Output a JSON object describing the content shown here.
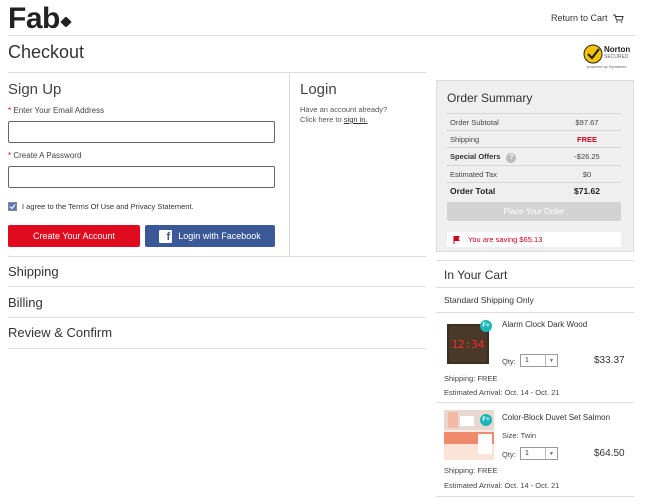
{
  "header": {
    "logo": "Fab",
    "return_to_cart": "Return to Cart"
  },
  "page_title": "Checkout",
  "norton": {
    "line1": "Norton",
    "line2": "SECURED",
    "line3": "powered by Symantec"
  },
  "signup": {
    "title": "Sign Up",
    "email_label": "Enter Your Email Address",
    "password_label": "Create A Password",
    "required_mark": "*",
    "agree_text": "I agree to the Terms Of Use and Privacy Statement.",
    "create_button": "Create Your Account",
    "facebook_button": "Login with Facebook"
  },
  "login": {
    "title": "Login",
    "line1": "Have an account already?",
    "line2_prefix": "Click here to",
    "sign_in_link": "sign in."
  },
  "steps": [
    "Shipping",
    "Billing",
    "Review & Confirm"
  ],
  "summary": {
    "title": "Order Summary",
    "rows": [
      {
        "label": "Order Subtotal",
        "value": "$97.67"
      },
      {
        "label": "Shipping",
        "value": "FREE"
      },
      {
        "label": "Special Offers",
        "value": "-$26.25"
      },
      {
        "label": "Estimated Tax",
        "value": "$0"
      },
      {
        "label": "Order Total",
        "value": "$71.62"
      }
    ],
    "question_mark": "?",
    "place_order": "Place Your Order",
    "saving": "You are saving $65.13",
    "colors": {
      "free": "#d0021b",
      "accent_red": "#e00b1e",
      "facebook": "#3b5998"
    }
  },
  "cart": {
    "title": "In Your Cart",
    "shipping_method": "Standard Shipping Only",
    "badge": "F+",
    "qty_label": "Qty:",
    "shipping_label": "Shipping:",
    "arrival_label": "Estimated Arrival:",
    "items": [
      {
        "name": "Alarm Clock Dark Wood",
        "size": "",
        "qty": "1",
        "price": "$33.37",
        "shipping": "FREE",
        "arrival": "Oct. 14 - Oct. 21",
        "clock_text": "12:34"
      },
      {
        "name": "Color-Block Duvet Set Salmon",
        "size_label": "Size:",
        "size": "Twin",
        "qty": "1",
        "price": "$64.50",
        "shipping": "FREE",
        "arrival": "Oct. 14 - Oct. 21"
      }
    ]
  }
}
